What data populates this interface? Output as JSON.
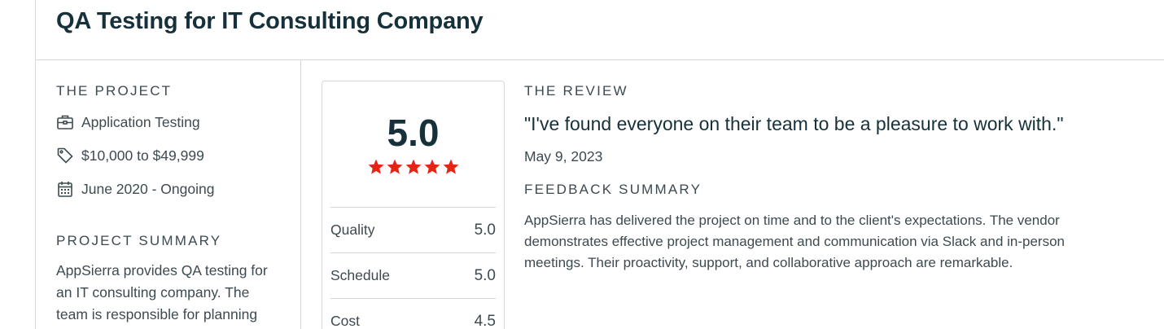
{
  "page_title": "QA Testing for IT Consulting Company",
  "project": {
    "heading": "THE PROJECT",
    "items": [
      {
        "icon": "briefcase-icon",
        "label": "Application Testing"
      },
      {
        "icon": "price-tag-icon",
        "label": "$10,000 to $49,999"
      },
      {
        "icon": "calendar-icon",
        "label": "June 2020 - Ongoing"
      }
    ],
    "summary_heading": "PROJECT SUMMARY",
    "summary_text": "AppSierra provides QA testing for an IT consulting company. The team is responsible for planning"
  },
  "rating": {
    "overall": "5.0",
    "stars": 5,
    "star_color": "#e62415",
    "rows": [
      {
        "label": "Quality",
        "value": "5.0"
      },
      {
        "label": "Schedule",
        "value": "5.0"
      },
      {
        "label": "Cost",
        "value": "4.5"
      }
    ]
  },
  "review": {
    "heading": "THE REVIEW",
    "quote": "\"I've found everyone on their team to be a pleasure to work with.\"",
    "date": "May 9, 2023",
    "feedback_heading": "FEEDBACK SUMMARY",
    "feedback_text": "AppSierra has delivered the project on time and to the client's expectations. The vendor demonstrates effective project management and communication via Slack and in-person meetings. Their proactivity, support, and collaborative approach are remarkable."
  }
}
